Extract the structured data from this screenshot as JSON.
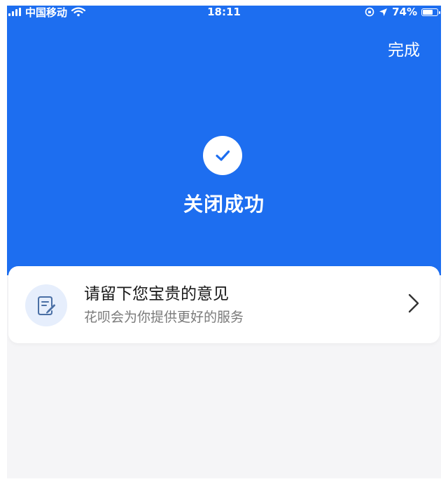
{
  "status_bar": {
    "carrier": "中国移动",
    "time": "18:11",
    "battery": "74%",
    "battery_level": 0.74
  },
  "header": {
    "done_label": "完成"
  },
  "result": {
    "title": "关闭成功"
  },
  "feedback": {
    "title": "请留下您宝贵的意见",
    "subtitle": "花呗会为你提供更好的服务"
  },
  "colors": {
    "accent": "#1d6ef0",
    "background": "#f5f5f7",
    "card": "#ffffff",
    "icon_bg": "#e6eefc"
  },
  "icons": {
    "signal": "signal-icon",
    "wifi": "wifi-icon",
    "lock": "orientation-lock-icon",
    "location": "location-icon",
    "battery": "battery-icon",
    "check": "check-icon",
    "feedback": "document-edit-icon",
    "chevron": "chevron-right-icon"
  }
}
